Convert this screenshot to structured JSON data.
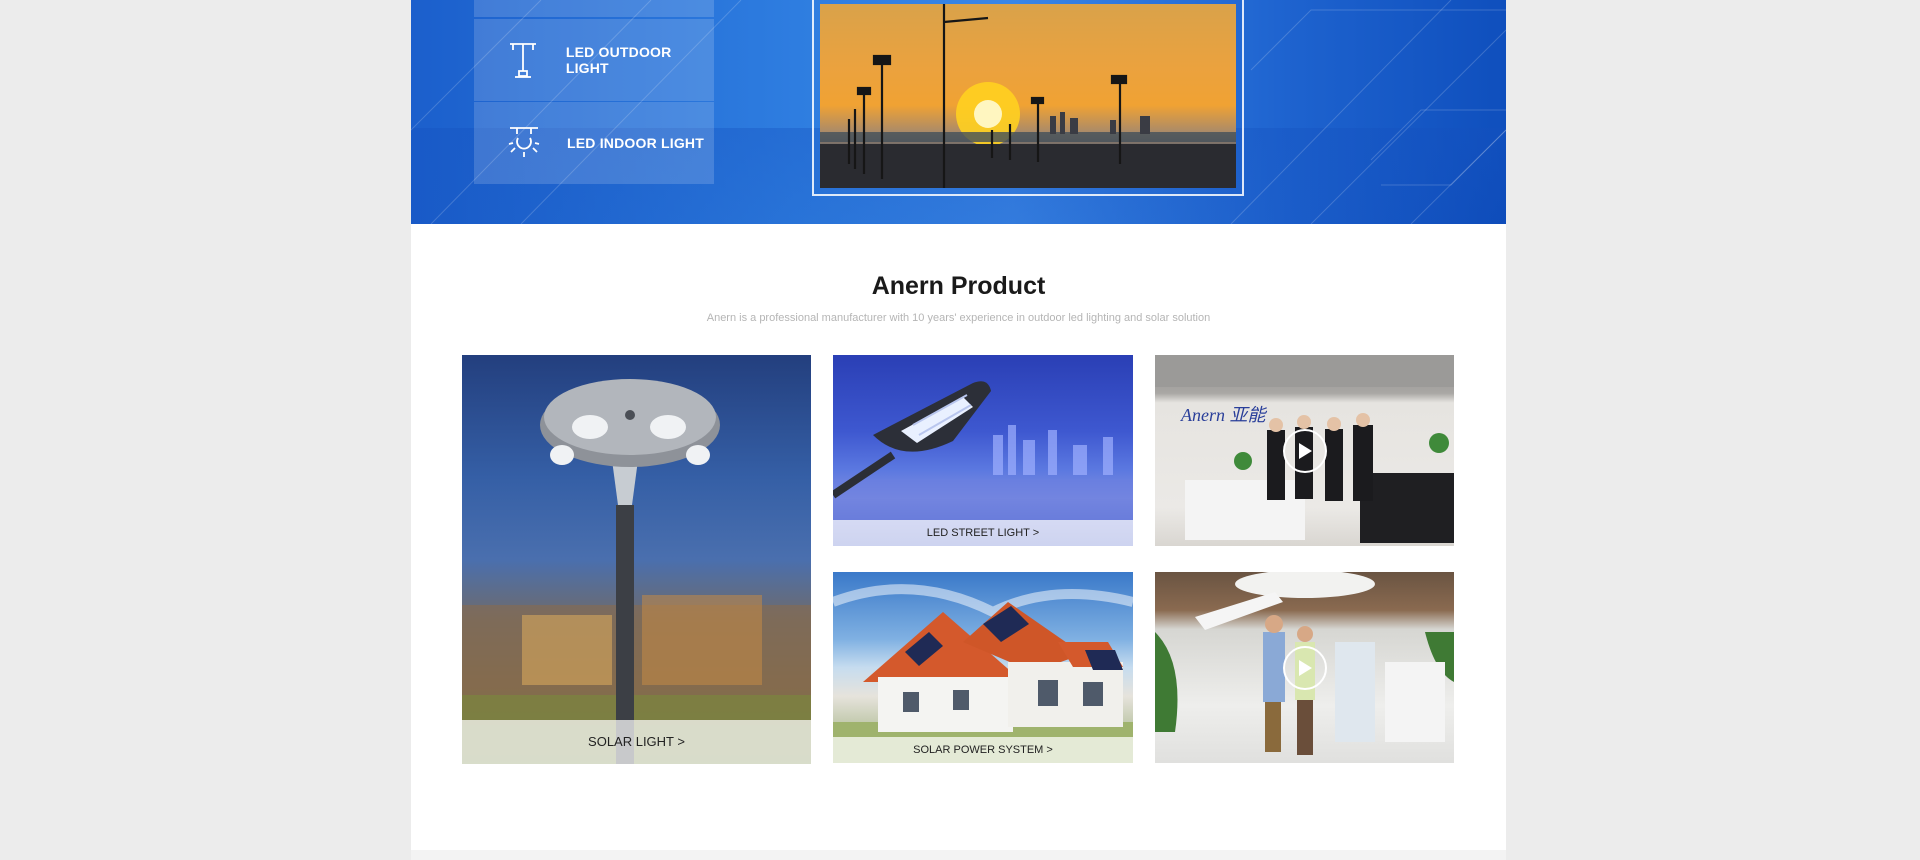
{
  "hero": {
    "menu": [
      {
        "label": "LED OUTDOOR LIGHT",
        "icon": "street-lamp-icon"
      },
      {
        "label": "LED INDOOR LIGHT",
        "icon": "ceiling-lamp-icon"
      }
    ]
  },
  "products": {
    "title": "Anern Product",
    "subtitle": "Anern is a professional manufacturer with 10 years' experience in outdoor led lighting and solar solution",
    "cards": {
      "solar_light": "SOLAR LIGHT >",
      "street_light": "LED STREET LIGHT >",
      "solar_power_system": "SOLAR POWER SYSTEM >",
      "video1_logo": "Anern 亚能"
    }
  },
  "colors": {
    "hero_blue": "#1e63cf",
    "page_bg": "#ececec",
    "content_bg": "#ffffff",
    "subtitle_gray": "#b5b5b5"
  }
}
